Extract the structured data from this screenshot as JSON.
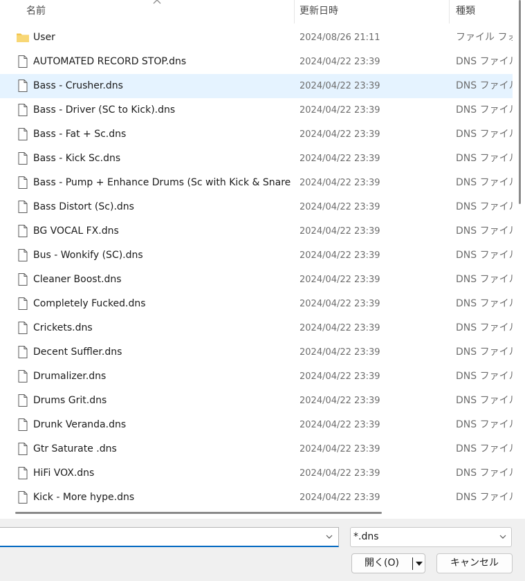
{
  "columns": {
    "name": "名前",
    "date": "更新日時",
    "type": "種類"
  },
  "rows": [
    {
      "name": "User",
      "date": "2024/08/26 21:11",
      "type": "ファイル フォルダー",
      "icon": "folder-icon"
    },
    {
      "name": "AUTOMATED RECORD STOP.dns",
      "date": "2024/04/22 23:39",
      "type": "DNS ファイル",
      "icon": "file-icon"
    },
    {
      "name": "Bass - Crusher.dns",
      "date": "2024/04/22 23:39",
      "type": "DNS ファイル",
      "icon": "file-icon",
      "selected": true
    },
    {
      "name": "Bass - Driver (SC to Kick).dns",
      "date": "2024/04/22 23:39",
      "type": "DNS ファイル",
      "icon": "file-icon"
    },
    {
      "name": "Bass - Fat + Sc.dns",
      "date": "2024/04/22 23:39",
      "type": "DNS ファイル",
      "icon": "file-icon"
    },
    {
      "name": "Bass - Kick Sc.dns",
      "date": "2024/04/22 23:39",
      "type": "DNS ファイル",
      "icon": "file-icon"
    },
    {
      "name": "Bass - Pump + Enhance Drums (Sc with Kick & Snare)....",
      "date": "2024/04/22 23:39",
      "type": "DNS ファイル",
      "icon": "file-icon"
    },
    {
      "name": "Bass Distort (Sc).dns",
      "date": "2024/04/22 23:39",
      "type": "DNS ファイル",
      "icon": "file-icon"
    },
    {
      "name": "BG VOCAL FX.dns",
      "date": "2024/04/22 23:39",
      "type": "DNS ファイル",
      "icon": "file-icon"
    },
    {
      "name": "Bus - Wonkify (SC).dns",
      "date": "2024/04/22 23:39",
      "type": "DNS ファイル",
      "icon": "file-icon"
    },
    {
      "name": "Cleaner Boost.dns",
      "date": "2024/04/22 23:39",
      "type": "DNS ファイル",
      "icon": "file-icon"
    },
    {
      "name": "Completely Fucked.dns",
      "date": "2024/04/22 23:39",
      "type": "DNS ファイル",
      "icon": "file-icon"
    },
    {
      "name": "Crickets.dns",
      "date": "2024/04/22 23:39",
      "type": "DNS ファイル",
      "icon": "file-icon"
    },
    {
      "name": "Decent Suffler.dns",
      "date": "2024/04/22 23:39",
      "type": "DNS ファイル",
      "icon": "file-icon"
    },
    {
      "name": "Drumalizer.dns",
      "date": "2024/04/22 23:39",
      "type": "DNS ファイル",
      "icon": "file-icon"
    },
    {
      "name": "Drums Grit.dns",
      "date": "2024/04/22 23:39",
      "type": "DNS ファイル",
      "icon": "file-icon"
    },
    {
      "name": "Drunk Veranda.dns",
      "date": "2024/04/22 23:39",
      "type": "DNS ファイル",
      "icon": "file-icon"
    },
    {
      "name": "Gtr Saturate .dns",
      "date": "2024/04/22 23:39",
      "type": "DNS ファイル",
      "icon": "file-icon"
    },
    {
      "name": "HiFi VOX.dns",
      "date": "2024/04/22 23:39",
      "type": "DNS ファイル",
      "icon": "file-icon"
    },
    {
      "name": "Kick - More hype.dns",
      "date": "2024/04/22 23:39",
      "type": "DNS ファイル",
      "icon": "file-icon"
    }
  ],
  "footer": {
    "filename_value": "",
    "filter_value": "*.dns",
    "open_label": "開く(O)",
    "cancel_label": "キャンセル"
  },
  "colors": {
    "selected_row": "#e5f3ff",
    "folder": "#f3c64d",
    "accent": "#0067c0"
  }
}
